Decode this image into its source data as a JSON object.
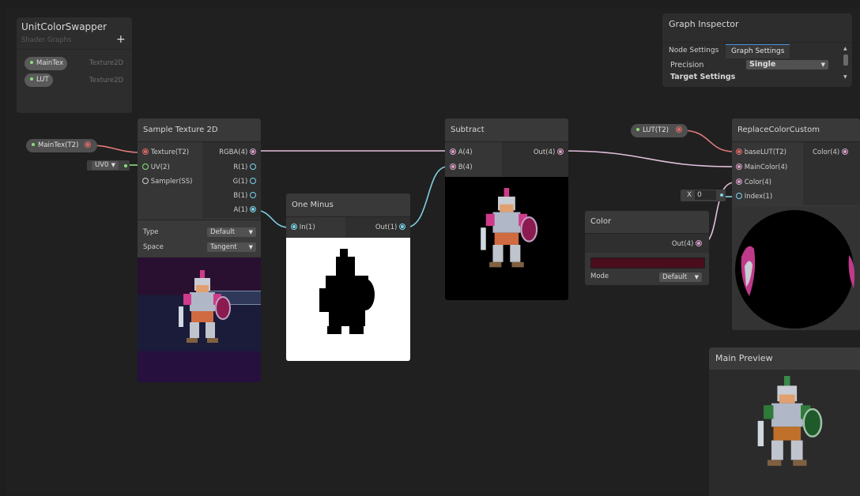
{
  "blackboard": {
    "title": "UnitColorSwapper",
    "subtitle": "Shader Graphs",
    "add_label": "+",
    "properties": [
      {
        "name": "MainTex",
        "type": "Texture2D"
      },
      {
        "name": "LUT",
        "type": "Texture2D"
      }
    ]
  },
  "inspector": {
    "title": "Graph Inspector",
    "tabs": [
      "Node Settings",
      "Graph Settings"
    ],
    "active_tab": "Graph Settings",
    "precision_label": "Precision",
    "precision_value": "Single",
    "target_settings_label": "Target Settings"
  },
  "property_nodes": {
    "maintex": "MainTex(T2)",
    "lut": "LUT(T2)"
  },
  "uv_inline": {
    "value": "UV0"
  },
  "sample_texture": {
    "title": "Sample Texture 2D",
    "inputs": [
      "Texture(T2)",
      "UV(2)",
      "Sampler(SS)"
    ],
    "outputs": [
      "RGBA(4)",
      "R(1)",
      "G(1)",
      "B(1)",
      "A(1)"
    ],
    "type_label": "Type",
    "type_value": "Default",
    "space_label": "Space",
    "space_value": "Tangent"
  },
  "one_minus": {
    "title": "One Minus",
    "input": "In(1)",
    "output": "Out(1)"
  },
  "subtract": {
    "title": "Subtract",
    "inputs": [
      "A(4)",
      "B(4)"
    ],
    "output": "Out(4)"
  },
  "color_node": {
    "title": "Color",
    "output": "Out(4)",
    "mode_label": "Mode",
    "mode_value": "Default",
    "swatch_color": "#4a0d1c"
  },
  "replace_node": {
    "title": "ReplaceColorCustom",
    "inputs": [
      "baseLUT(T2)",
      "MainColor(4)",
      "Color(4)",
      "Index(1)"
    ],
    "output": "Color(4)"
  },
  "index_inline": {
    "label": "X",
    "value": "0"
  },
  "main_preview": {
    "title": "Main Preview"
  },
  "colors": {
    "texture_wire": "#e07a7a",
    "vector4_wire": "#e2bedc",
    "float_wire": "#7fcfe0",
    "vector2_wire": "#8ae07a"
  }
}
